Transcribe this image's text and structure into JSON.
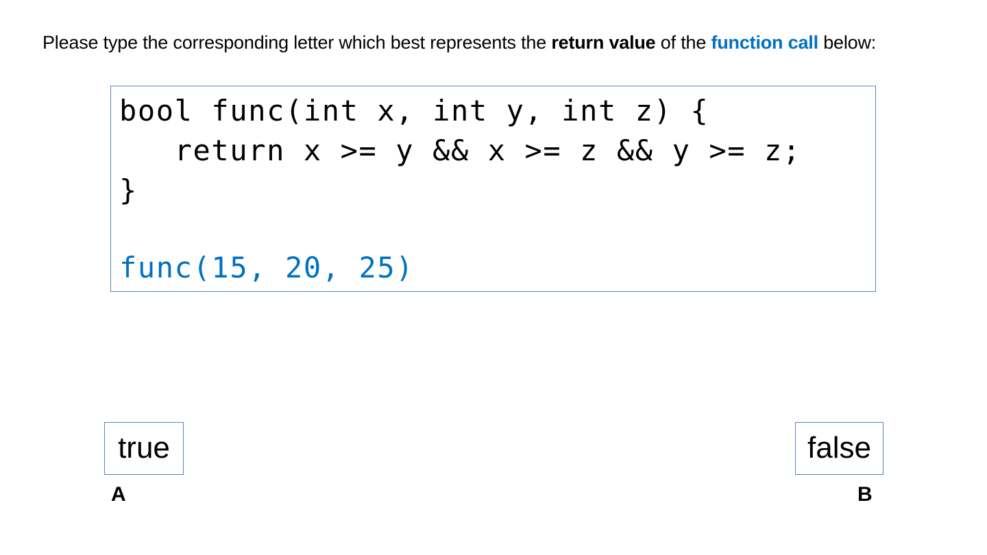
{
  "prompt": {
    "part1": "Please type the corresponding letter which best represents the ",
    "bold": "return value",
    "part2": " of the ",
    "accent": "function call",
    "part3": " below:"
  },
  "code": {
    "line1": "bool func(int x, int y, int z) {",
    "line2": "   return x >= y && x >= z && y >= z;",
    "line3": "}",
    "call": "func(15, 20, 25)"
  },
  "choices": [
    {
      "text": "true",
      "letter": "A"
    },
    {
      "text": "false",
      "letter": "B"
    }
  ],
  "colors": {
    "accent": "#0070c0",
    "box_border": "#5b7fbf"
  }
}
